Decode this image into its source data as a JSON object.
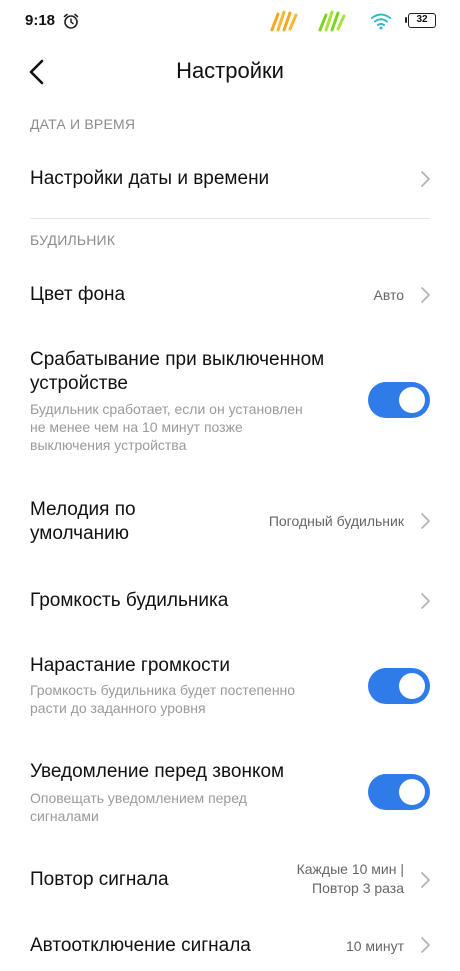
{
  "status_bar": {
    "time": "9:18",
    "battery": "32"
  },
  "header": {
    "title": "Настройки"
  },
  "sections": {
    "datetime": {
      "header": "ДАТА И ВРЕМЯ",
      "datetime_settings": {
        "title": "Настройки даты и времени"
      }
    },
    "alarm": {
      "header": "БУДИЛЬНИК",
      "bg_color": {
        "title": "Цвет фона",
        "value": "Авто"
      },
      "powered_off": {
        "title_line1": "Срабатывание при выключенном",
        "title_line2": "устройстве",
        "desc_line1": "Будильник сработает, если он установлен",
        "desc_line2": "не менее чем на 10 минут позже",
        "desc_line3": "выключения устройства",
        "enabled": true
      },
      "default_ringtone": {
        "title_line1": "Мелодия по",
        "title_line2": "умолчанию",
        "value": "Погодный будильник"
      },
      "alarm_volume": {
        "title": "Громкость будильника"
      },
      "volume_rise": {
        "title": "Нарастание громкости",
        "desc_line1": "Громкость будильника будет постепенно",
        "desc_line2": "расти до заданного уровня",
        "enabled": true
      },
      "pre_alarm_notice": {
        "title": "Уведомление перед звонком",
        "desc_line1": "Оповещать уведомлением перед",
        "desc_line2": "сигналами",
        "enabled": true
      },
      "snooze": {
        "title": "Повтор сигнала",
        "value_line1": "Каждые 10 мин |",
        "value_line2": "Повтор 3 раза"
      },
      "auto_off": {
        "title": "Автоотключение сигнала",
        "value": "10 минут"
      }
    }
  },
  "colors": {
    "accent": "#2f7bea",
    "section_header": "#8c8c8c",
    "secondary_text": "#9a9a9a"
  }
}
